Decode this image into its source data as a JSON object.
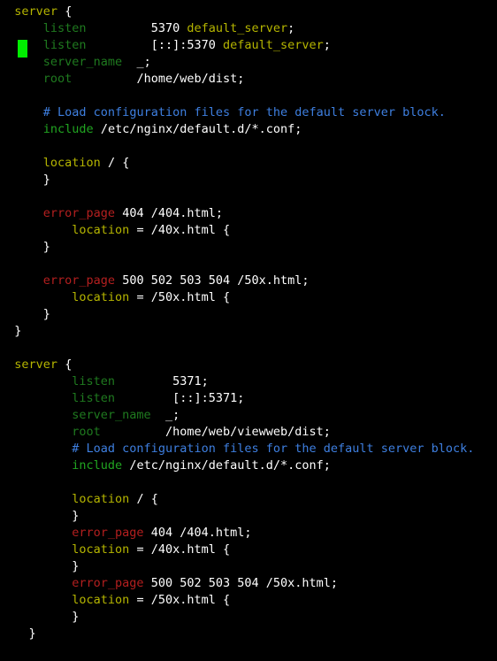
{
  "terminal": {
    "background_color": "#000000",
    "font_color": "#ffffff",
    "cursor": {
      "name": "block-cursor",
      "color": "#00ee00",
      "line_index": 2,
      "column": 0
    },
    "colors": {
      "plain": "#ffffff",
      "keyword": "#b5b500",
      "directive": "#1f7a1f",
      "include": "#21a521",
      "comment": "#3e7fe0",
      "error": "#b41f1f"
    }
  },
  "file": {
    "language": "nginx",
    "lines": [
      {
        "indent": "  ",
        "tokens": [
          {
            "t": "keyword",
            "v": "server"
          },
          {
            "t": "plain",
            "v": " "
          },
          {
            "t": "brace",
            "v": "{"
          }
        ]
      },
      {
        "indent": "      ",
        "tokens": [
          {
            "t": "directive",
            "v": "listen"
          },
          {
            "t": "plain",
            "v": "         5370 "
          },
          {
            "t": "keyword",
            "v": "default_server"
          },
          {
            "t": "plain",
            "v": ";"
          }
        ]
      },
      {
        "indent": "      ",
        "tokens": [
          {
            "t": "directive",
            "v": "listen"
          },
          {
            "t": "plain",
            "v": "         [::]:5370 "
          },
          {
            "t": "keyword",
            "v": "default_server"
          },
          {
            "t": "plain",
            "v": ";"
          }
        ]
      },
      {
        "indent": "      ",
        "tokens": [
          {
            "t": "directive",
            "v": "server_name"
          },
          {
            "t": "plain",
            "v": "  _;"
          }
        ]
      },
      {
        "indent": "      ",
        "tokens": [
          {
            "t": "directive",
            "v": "root"
          },
          {
            "t": "plain",
            "v": "         /home/web/dist;"
          }
        ]
      },
      {
        "indent": "",
        "tokens": []
      },
      {
        "indent": "      ",
        "tokens": [
          {
            "t": "comment",
            "v": "# Load configuration files for the default server block."
          }
        ]
      },
      {
        "indent": "      ",
        "tokens": [
          {
            "t": "include",
            "v": "include"
          },
          {
            "t": "plain",
            "v": " /etc/nginx/default.d/*.conf;"
          }
        ]
      },
      {
        "indent": "",
        "tokens": []
      },
      {
        "indent": "      ",
        "tokens": [
          {
            "t": "keyword",
            "v": "location"
          },
          {
            "t": "plain",
            "v": " / "
          },
          {
            "t": "brace",
            "v": "{"
          }
        ]
      },
      {
        "indent": "      ",
        "tokens": [
          {
            "t": "brace",
            "v": "}"
          }
        ]
      },
      {
        "indent": "",
        "tokens": []
      },
      {
        "indent": "      ",
        "tokens": [
          {
            "t": "error",
            "v": "error_page"
          },
          {
            "t": "plain",
            "v": " 404 /404.html;"
          }
        ]
      },
      {
        "indent": "          ",
        "tokens": [
          {
            "t": "keyword",
            "v": "location"
          },
          {
            "t": "plain",
            "v": " = /40x.html "
          },
          {
            "t": "brace",
            "v": "{"
          }
        ]
      },
      {
        "indent": "      ",
        "tokens": [
          {
            "t": "brace",
            "v": "}"
          }
        ]
      },
      {
        "indent": "",
        "tokens": []
      },
      {
        "indent": "      ",
        "tokens": [
          {
            "t": "error",
            "v": "error_page"
          },
          {
            "t": "plain",
            "v": " 500 502 503 504 /50x.html;"
          }
        ]
      },
      {
        "indent": "          ",
        "tokens": [
          {
            "t": "keyword",
            "v": "location"
          },
          {
            "t": "plain",
            "v": " = /50x.html "
          },
          {
            "t": "brace",
            "v": "{"
          }
        ]
      },
      {
        "indent": "      ",
        "tokens": [
          {
            "t": "brace",
            "v": "}"
          }
        ]
      },
      {
        "indent": "  ",
        "tokens": [
          {
            "t": "brace",
            "v": "}"
          }
        ]
      },
      {
        "indent": "",
        "tokens": []
      },
      {
        "indent": "  ",
        "tokens": [
          {
            "t": "keyword",
            "v": "server"
          },
          {
            "t": "plain",
            "v": " "
          },
          {
            "t": "brace",
            "v": "{"
          }
        ]
      },
      {
        "indent": "          ",
        "tokens": [
          {
            "t": "directive",
            "v": "listen"
          },
          {
            "t": "plain",
            "v": "        5371;"
          }
        ]
      },
      {
        "indent": "          ",
        "tokens": [
          {
            "t": "directive",
            "v": "listen"
          },
          {
            "t": "plain",
            "v": "        [::]:5371;"
          }
        ]
      },
      {
        "indent": "          ",
        "tokens": [
          {
            "t": "directive",
            "v": "server_name"
          },
          {
            "t": "plain",
            "v": "  _;"
          }
        ]
      },
      {
        "indent": "          ",
        "tokens": [
          {
            "t": "directive",
            "v": "root"
          },
          {
            "t": "plain",
            "v": "         /home/web/viewweb/dist;"
          }
        ]
      },
      {
        "indent": "          ",
        "tokens": [
          {
            "t": "comment",
            "v": "# Load configuration files for the default server block."
          }
        ]
      },
      {
        "indent": "          ",
        "tokens": [
          {
            "t": "include",
            "v": "include"
          },
          {
            "t": "plain",
            "v": " /etc/nginx/default.d/*.conf;"
          }
        ]
      },
      {
        "indent": "",
        "tokens": []
      },
      {
        "indent": "          ",
        "tokens": [
          {
            "t": "keyword",
            "v": "location"
          },
          {
            "t": "plain",
            "v": " / "
          },
          {
            "t": "brace",
            "v": "{"
          }
        ]
      },
      {
        "indent": "          ",
        "tokens": [
          {
            "t": "brace",
            "v": "}"
          }
        ]
      },
      {
        "indent": "          ",
        "tokens": [
          {
            "t": "error",
            "v": "error_page"
          },
          {
            "t": "plain",
            "v": " 404 /404.html;"
          }
        ]
      },
      {
        "indent": "          ",
        "tokens": [
          {
            "t": "keyword",
            "v": "location"
          },
          {
            "t": "plain",
            "v": " = /40x.html "
          },
          {
            "t": "brace",
            "v": "{"
          }
        ]
      },
      {
        "indent": "          ",
        "tokens": [
          {
            "t": "brace",
            "v": "}"
          }
        ]
      },
      {
        "indent": "          ",
        "tokens": [
          {
            "t": "error",
            "v": "error_page"
          },
          {
            "t": "plain",
            "v": " 500 502 503 504 /50x.html;"
          }
        ]
      },
      {
        "indent": "          ",
        "tokens": [
          {
            "t": "keyword",
            "v": "location"
          },
          {
            "t": "plain",
            "v": " = /50x.html "
          },
          {
            "t": "brace",
            "v": "{"
          }
        ]
      },
      {
        "indent": "          ",
        "tokens": [
          {
            "t": "brace",
            "v": "}"
          }
        ]
      },
      {
        "indent": "    ",
        "tokens": [
          {
            "t": "brace",
            "v": "}"
          }
        ]
      }
    ]
  }
}
